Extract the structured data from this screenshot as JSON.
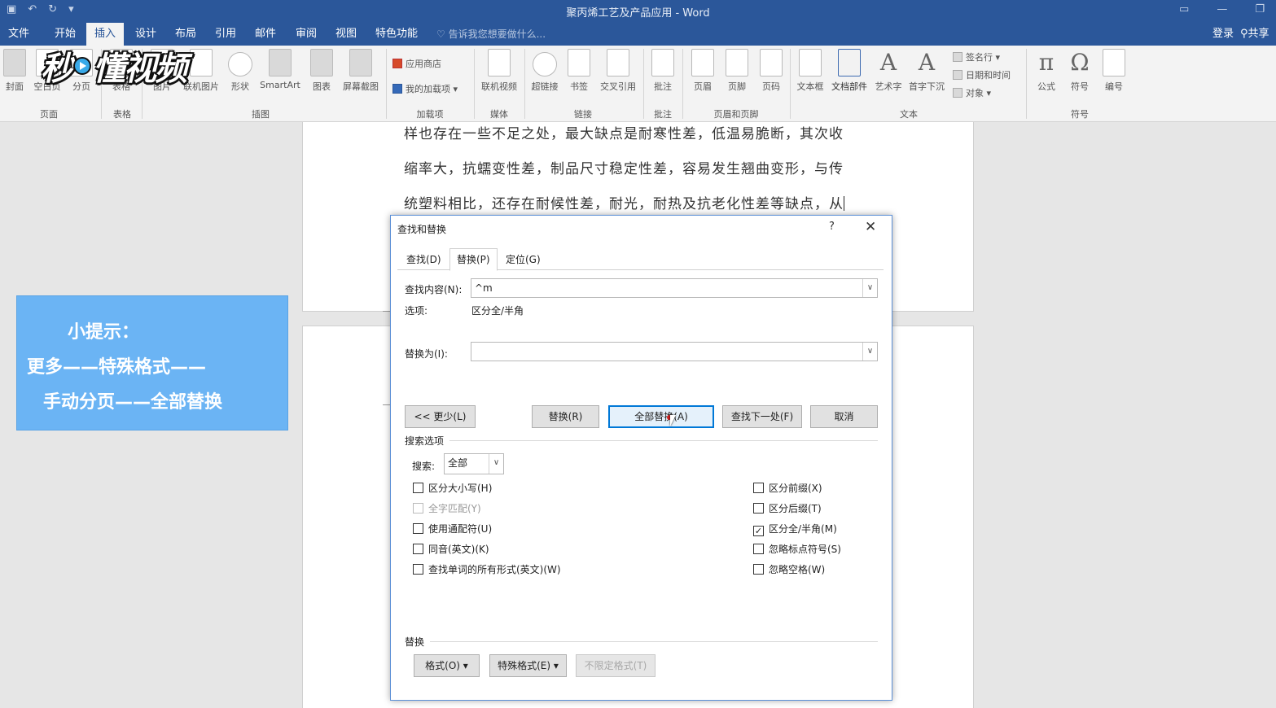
{
  "app": {
    "title": "聚丙烯工艺及产品应用 - Word",
    "qat_icons": [
      "save-icon",
      "undo-icon",
      "redo-icon",
      "customize-icon"
    ]
  },
  "menu": {
    "tabs": [
      "文件",
      "开始",
      "插入",
      "设计",
      "布局",
      "引用",
      "邮件",
      "审阅",
      "视图",
      "特色功能"
    ],
    "active_tab": "插入",
    "tell_me": "告诉我您想要做什么...",
    "login": "登录",
    "share": "共享"
  },
  "ribbon": {
    "pages": {
      "label": "页面",
      "items": [
        "封面",
        "空白页",
        "分页"
      ]
    },
    "tables": {
      "label": "表格",
      "items": [
        "表格"
      ]
    },
    "illustrations": {
      "label": "插图",
      "items": [
        "图片",
        "联机图片",
        "形状",
        "SmartArt",
        "图表",
        "屏幕截图"
      ]
    },
    "addins": {
      "label": "加载项",
      "items": [
        "应用商店",
        "我的加载项"
      ]
    },
    "media": {
      "label": "媒体",
      "items": [
        "联机视频"
      ]
    },
    "links": {
      "label": "链接",
      "items": [
        "超链接",
        "书签",
        "交叉引用"
      ]
    },
    "comments": {
      "label": "批注",
      "items": [
        "批注"
      ]
    },
    "header_footer": {
      "label": "页眉和页脚",
      "items": [
        "页眉",
        "页脚",
        "页码"
      ]
    },
    "text": {
      "label": "文本",
      "items": [
        "文本框",
        "文档部件",
        "艺术字",
        "首字下沉"
      ],
      "list": [
        "签名行",
        "日期和时间",
        "对象"
      ]
    },
    "symbols": {
      "label": "符号",
      "items": [
        "公式",
        "符号",
        "编号"
      ]
    }
  },
  "logo_text": "秒懂视频",
  "document": {
    "lines": [
      "样也存在一些不足之处，最大缺点是耐寒性差，低温易脆断，其次收",
      "缩率大，抗蠕变性差，制品尺寸稳定性差，容易发生翘曲变形，与传",
      "统塑料相比，还存在耐候性差，耐光，耐热及抗老化性差等缺点，从"
    ]
  },
  "tip": {
    "line1": "小提示：",
    "line2": "更多——特殊格式——",
    "line3": "手动分页——全部替换"
  },
  "dialog": {
    "title": "查找和替换",
    "help": "?",
    "close": "✕",
    "tabs": [
      "查找(D)",
      "替换(P)",
      "定位(G)"
    ],
    "active_tab": "替换(P)",
    "find_label": "查找内容(N):",
    "find_value": "^m",
    "options_label": "选项:",
    "options_value": "区分全/半角",
    "replace_label": "替换为(I):",
    "replace_value": "",
    "buttons": {
      "less": "<< 更少(L)",
      "replace": "替换(R)",
      "replace_all": "全部替换(A)",
      "find_next": "查找下一处(F)",
      "cancel": "取消"
    },
    "search_section": "搜索选项",
    "search_label": "搜索:",
    "search_value": "全部",
    "checkboxes_left": [
      {
        "label": "区分大小写(H)",
        "checked": false,
        "disabled": false
      },
      {
        "label": "全字匹配(Y)",
        "checked": false,
        "disabled": true
      },
      {
        "label": "使用通配符(U)",
        "checked": false,
        "disabled": false
      },
      {
        "label": "同音(英文)(K)",
        "checked": false,
        "disabled": false
      },
      {
        "label": "查找单词的所有形式(英文)(W)",
        "checked": false,
        "disabled": false
      }
    ],
    "checkboxes_right": [
      {
        "label": "区分前缀(X)",
        "checked": false,
        "disabled": false
      },
      {
        "label": "区分后缀(T)",
        "checked": false,
        "disabled": false
      },
      {
        "label": "区分全/半角(M)",
        "checked": true,
        "disabled": false
      },
      {
        "label": "忽略标点符号(S)",
        "checked": false,
        "disabled": false
      },
      {
        "label": "忽略空格(W)",
        "checked": false,
        "disabled": false
      }
    ],
    "replace_section": "替换",
    "format_button": "格式(O) ▾",
    "special_button": "特殊格式(E) ▾",
    "no_format_button": "不限定格式(T)"
  },
  "colors": {
    "titlebar": "#2b579a",
    "tip_bg": "#6bb4f4",
    "primary_border": "#0078d7"
  }
}
